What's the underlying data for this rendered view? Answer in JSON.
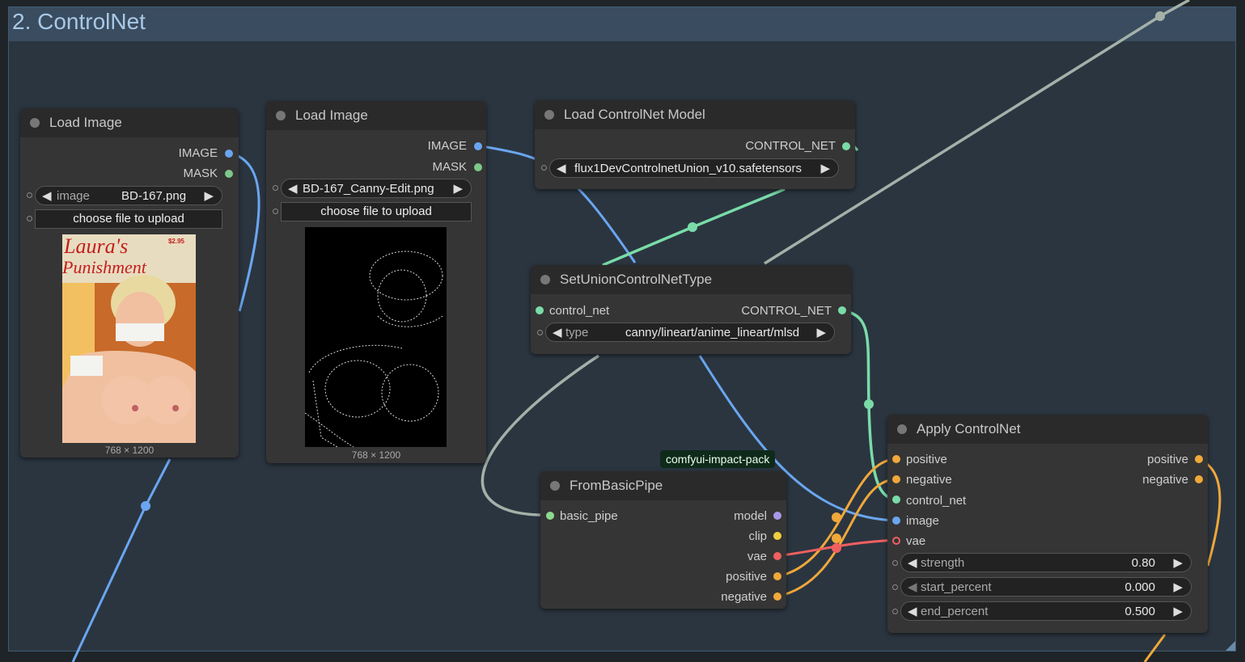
{
  "group": {
    "title": "2. ControlNet"
  },
  "colors": {
    "image": "#6aa6ef",
    "mask": "#7dc88a",
    "control_net": "#79dca8",
    "conditioning": "#f0a83a",
    "vae": "#f06060",
    "model": "#a898e8",
    "clip": "#f0d040",
    "basic_pipe": "#8fd88f",
    "wire_gray": "#a0b0a8"
  },
  "load_image_1": {
    "title": "Load Image",
    "outputs": [
      "IMAGE",
      "MASK"
    ],
    "image_label": "image",
    "image_value": "BD-167.png",
    "upload_label": "choose file to upload",
    "cover_title_1": "Laura's",
    "cover_title_2": "Punishment",
    "cover_price": "$2.95",
    "dims": "768 × 1200"
  },
  "load_image_2": {
    "title": "Load Image",
    "outputs": [
      "IMAGE",
      "MASK"
    ],
    "image_value": "BD-167_Canny-Edit.png",
    "upload_label": "choose file to upload",
    "dims": "768 × 1200"
  },
  "load_controlnet": {
    "title": "Load ControlNet Model",
    "output": "CONTROL_NET",
    "model_value": "flux1DevControlnetUnion_v10.safetensors"
  },
  "set_union": {
    "title": "SetUnionControlNetType",
    "input": "control_net",
    "output": "CONTROL_NET",
    "type_label": "type",
    "type_value": "canny/lineart/anime_lineart/mlsd"
  },
  "from_basic_pipe": {
    "title": "FromBasicPipe",
    "badge": "comfyui-impact-pack",
    "input": "basic_pipe",
    "outputs": [
      "model",
      "clip",
      "vae",
      "positive",
      "negative"
    ]
  },
  "apply_controlnet": {
    "title": "Apply ControlNet",
    "inputs": [
      "positive",
      "negative",
      "control_net",
      "image",
      "vae"
    ],
    "outputs": [
      "positive",
      "negative"
    ],
    "strength_label": "strength",
    "strength_value": "0.80",
    "start_label": "start_percent",
    "start_value": "0.000",
    "end_label": "end_percent",
    "end_value": "0.500"
  }
}
